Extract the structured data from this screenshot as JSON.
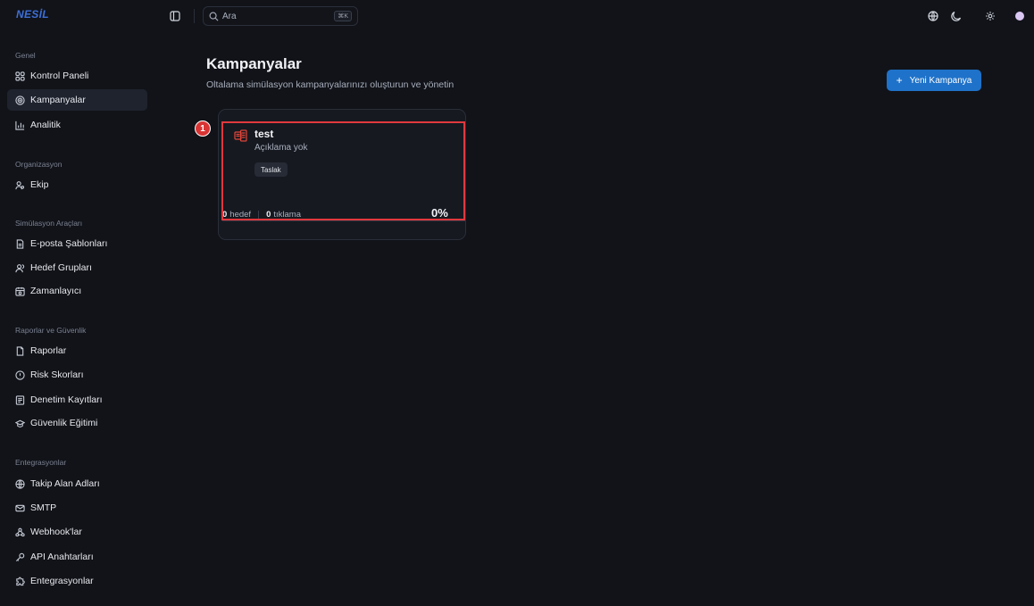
{
  "brand": "NESİL",
  "search": {
    "placeholder": "Ara",
    "shortcut": "⌘K"
  },
  "sidebar": {
    "sections": [
      {
        "label": "Genel",
        "items": [
          {
            "label": "Kontrol Paneli",
            "icon": "grid-icon"
          },
          {
            "label": "Kampanyalar",
            "icon": "target-icon",
            "active": true
          },
          {
            "label": "Analitik",
            "icon": "bar-chart-icon"
          }
        ]
      },
      {
        "label": "Organizasyon",
        "items": [
          {
            "label": "Ekip",
            "icon": "users-icon"
          }
        ]
      },
      {
        "label": "Simülasyon Araçları",
        "items": [
          {
            "label": "E-posta Şablonları",
            "icon": "file-text-icon"
          },
          {
            "label": "Hedef Grupları",
            "icon": "user-group-icon"
          },
          {
            "label": "Zamanlayıcı",
            "icon": "calendar-icon"
          }
        ]
      },
      {
        "label": "Raporlar ve Güvenlik",
        "items": [
          {
            "label": "Raporlar",
            "icon": "report-icon"
          },
          {
            "label": "Risk Skorları",
            "icon": "shield-icon"
          },
          {
            "label": "Denetim Kayıtları",
            "icon": "audit-icon"
          },
          {
            "label": "Güvenlik Eğitimi",
            "icon": "graduation-cap-icon"
          }
        ]
      },
      {
        "label": "Entegrasyonlar",
        "items": [
          {
            "label": "Takip Alan Adları",
            "icon": "globe-icon"
          },
          {
            "label": "SMTP",
            "icon": "mail-icon"
          },
          {
            "label": "Webhook'lar",
            "icon": "webhook-icon"
          },
          {
            "label": "API Anahtarları",
            "icon": "key-icon"
          },
          {
            "label": "Entegrasyonlar",
            "icon": "puzzle-icon"
          }
        ]
      }
    ]
  },
  "header": {
    "title": "Kampanyalar",
    "subtitle": "Oltalama simülasyon kampanyalarınızı oluşturun ve yönetin",
    "new_button": "Yeni Kampanya"
  },
  "campaign": {
    "marker": "1",
    "name": "test",
    "description": "Açıklama yok",
    "status": "Taslak",
    "targets_count": "0",
    "targets_label": "hedef",
    "clicks_count": "0",
    "clicks_label": "tıklama",
    "percent": "0%"
  },
  "colors": {
    "accent": "#1f72c9",
    "highlight": "#e0393e",
    "campaign_icon": "#e0463a"
  }
}
